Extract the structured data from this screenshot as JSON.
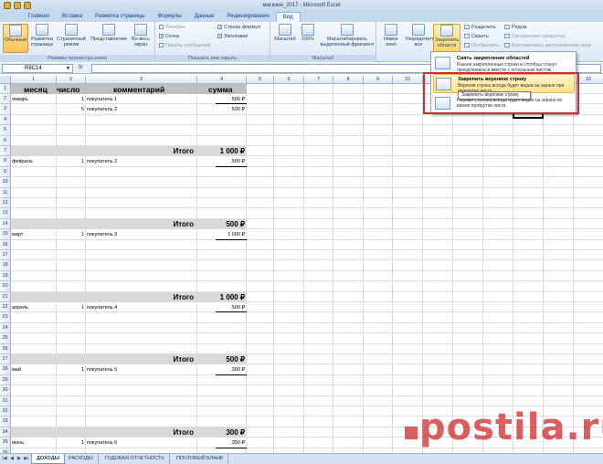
{
  "window_title": "магазин_2017 - Microsoft Excel",
  "tabs": [
    "Главная",
    "Вставка",
    "Разметка страницы",
    "Формулы",
    "Данные",
    "Рецензирование",
    "Вид"
  ],
  "active_tab": "Вид",
  "ribbon": {
    "view_modes": {
      "caption": "Режимы просмотра книги",
      "normal": "Обычный",
      "page_layout": "Разметка страницы",
      "page_break": "Страничный режим",
      "custom_views": "Представления",
      "full_screen": "Во весь экран"
    },
    "show_hide": {
      "caption": "Показать или скрыть",
      "ruler": "Линейка",
      "gridlines": "Сетка",
      "message_bar": "Панель сообщений",
      "formula_bar": "Строка формул",
      "headings": "Заголовки"
    },
    "zoom": {
      "caption": "Масштаб",
      "zoom": "Масштаб",
      "hundred": "100%",
      "zoom_selection": "Масштабировать выделенный фрагмент"
    },
    "window": {
      "new_window": "Новое окно",
      "arrange_all": "Упорядочить все",
      "freeze_panes": "Закрепить области",
      "split": "Разделить",
      "hide": "Скрыть",
      "unhide": "Отобразить",
      "side_by_side": "Рядом",
      "sync_scroll": "Синхронная прокрутка",
      "reset_position": "Восстановить расположение окна"
    }
  },
  "formula_bar": {
    "name_box": "R8C14",
    "fx": "fx",
    "formula": ""
  },
  "columns": [
    "1",
    "2",
    "3",
    "4",
    "5",
    "6",
    "7",
    "8",
    "9",
    "10",
    "11",
    "12",
    "13",
    "14",
    "15",
    "16"
  ],
  "rows": [
    "1",
    "2",
    "3",
    "4",
    "5",
    "6",
    "7",
    "8",
    "9",
    "10",
    "11",
    "12",
    "13",
    "14",
    "15",
    "16",
    "17",
    "18",
    "19",
    "20",
    "21",
    "22",
    "23",
    "24",
    "25",
    "26",
    "27",
    "28",
    "29",
    "30",
    "31",
    "32",
    "33",
    "34",
    "35",
    "36"
  ],
  "table": {
    "headers": [
      "месяц",
      "число",
      "комментарий",
      "сумма"
    ],
    "cells": {
      "r2": {
        "month": "январь",
        "num": "1",
        "comment": "покупатель 1",
        "sum": "500 ₽"
      },
      "r3": {
        "month": "",
        "num": "5",
        "comment": "покупатель 2",
        "sum": "500 ₽"
      },
      "r8": {
        "month": "февраль",
        "num": "1",
        "comment": "покупатель 2",
        "sum": "500 ₽"
      },
      "r15": {
        "month": "март",
        "num": "1",
        "comment": "покупатель 3",
        "sum": "1 000 ₽"
      },
      "r22": {
        "month": "апрель",
        "num": "1",
        "comment": "покупатель 4",
        "sum": "500 ₽"
      },
      "r28": {
        "month": "май",
        "num": "1",
        "comment": "покупатель 5",
        "sum": "300 ₽"
      },
      "r35": {
        "month": "июнь",
        "num": "1",
        "comment": "покупатель 6",
        "sum": "350 ₽"
      }
    },
    "totals": {
      "label": "Итого",
      "r7": "1 000 ₽",
      "r14": "500 ₽",
      "r21": "1 000 ₽",
      "r27": "500 ₽",
      "r34": "300 ₽"
    }
  },
  "freeze_menu": {
    "unfreeze_title": "Снять закрепление областей",
    "unfreeze_desc": "Разное закрепленные строки и столбцы станут прокручиваться вместе с остальным листом.",
    "top_row_title": "Закрепить верхнюю строку",
    "top_row_desc": "Верхняя строка всегда будет видна на экране при прокрутке листа.",
    "first_col_desc": "Первый столбец всегда будет виден на экране во время прокрутки листа.",
    "tooltip": "Закрепить верхнюю строку"
  },
  "sheet_tabs": [
    "ДОХОДЫ",
    "РАСХОДЫ",
    "ГОДОВАЯ ОТЧЕТНОСТЬ",
    "ПОЧТОВЫЙ БЛАНК"
  ],
  "active_sheet": "ДОХОДЫ",
  "watermark": "postila.ru",
  "colors": {
    "header_band": "#bfbfbf",
    "total_band": "#d9d9d9",
    "highlight_box": "#d12b2b",
    "ribbon_bg": "#dce8f6"
  }
}
